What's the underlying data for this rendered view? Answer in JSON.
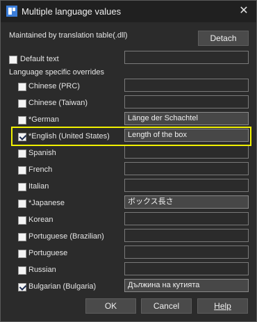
{
  "window": {
    "title": "Multiple language values",
    "close_glyph": "✕"
  },
  "header": {
    "maintained_text": "Maintained by translation table(.dll)",
    "detach_label": "Detach"
  },
  "default_text": {
    "label": "Default text",
    "checked": false,
    "value": ""
  },
  "overrides_label": "Language specific overrides",
  "languages": [
    {
      "label": "Chinese (PRC)",
      "checked": false,
      "value": ""
    },
    {
      "label": "Chinese (Taiwan)",
      "checked": false,
      "value": ""
    },
    {
      "label": "*German",
      "checked": false,
      "value": "Länge der Schachtel"
    },
    {
      "label": "*English (United States)",
      "checked": true,
      "value": "Length of the box"
    },
    {
      "label": "Spanish",
      "checked": false,
      "value": ""
    },
    {
      "label": "French",
      "checked": false,
      "value": ""
    },
    {
      "label": "Italian",
      "checked": false,
      "value": ""
    },
    {
      "label": "*Japanese",
      "checked": false,
      "value": "ボックス長さ"
    },
    {
      "label": "Korean",
      "checked": false,
      "value": ""
    },
    {
      "label": "Portuguese (Brazilian)",
      "checked": false,
      "value": ""
    },
    {
      "label": "Portuguese",
      "checked": false,
      "value": ""
    },
    {
      "label": "Russian",
      "checked": false,
      "value": ""
    },
    {
      "label": "Bulgarian (Bulgaria)",
      "checked": true,
      "value": "Дължина на кутията"
    }
  ],
  "footer": {
    "ok_label": "OK",
    "cancel_label": "Cancel",
    "help_label": "Help"
  },
  "colors": {
    "highlight": "#f2f200",
    "background": "#2b2b2b"
  },
  "icons": {
    "app": "app-logo-icon",
    "close": "close-icon",
    "check": "checkmark-icon"
  }
}
